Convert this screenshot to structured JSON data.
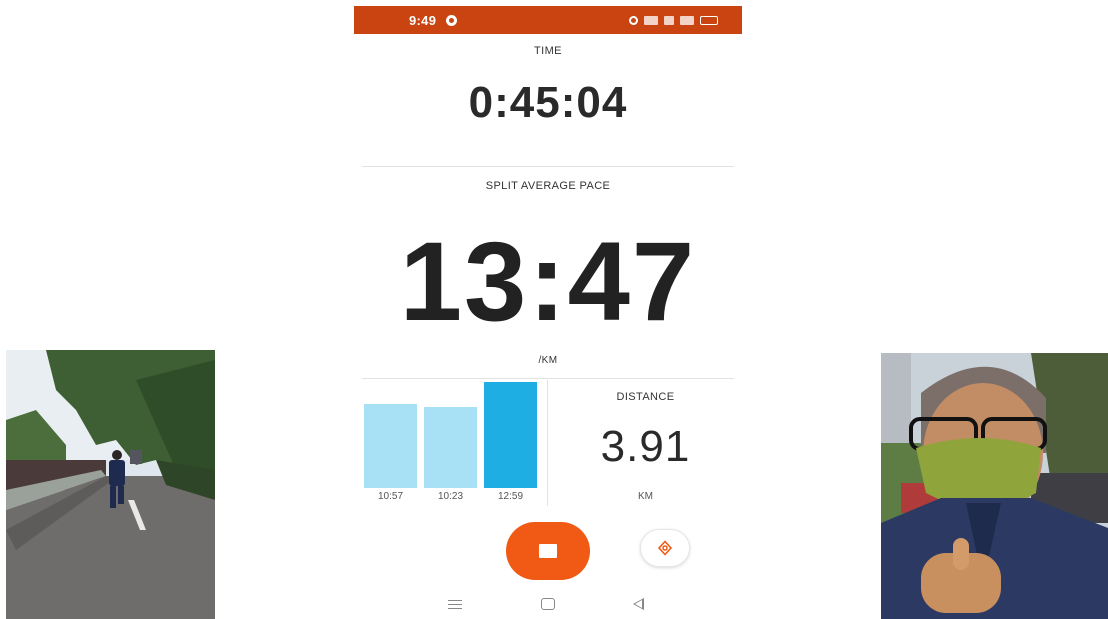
{
  "status_bar": {
    "time": "9:49",
    "color": "#c94410"
  },
  "time": {
    "label": "TIME",
    "value": "0:45:04"
  },
  "pace": {
    "label": "SPLIT AVERAGE PACE",
    "value": "13:47",
    "unit": "/KM"
  },
  "splits": [
    {
      "label": "10:57",
      "relative_height": 0.78,
      "color": "#a8e1f6"
    },
    {
      "label": "10:23",
      "relative_height": 0.75,
      "color": "#a8e1f6"
    },
    {
      "label": "12:59",
      "relative_height": 0.98,
      "color": "#1eaee4"
    }
  ],
  "distance": {
    "label": "DISTANCE",
    "value": "3.91",
    "unit": "KM"
  },
  "controls": {
    "stop_color": "#f05a14",
    "stop_icon": "stop-icon",
    "beacon_icon": "beacon-icon"
  },
  "nav_icons": [
    "menu-icon",
    "home-icon",
    "back-icon"
  ],
  "photos": {
    "left": "runner-on-road-photo",
    "right": "masked-runner-thumbs-up-photo"
  }
}
